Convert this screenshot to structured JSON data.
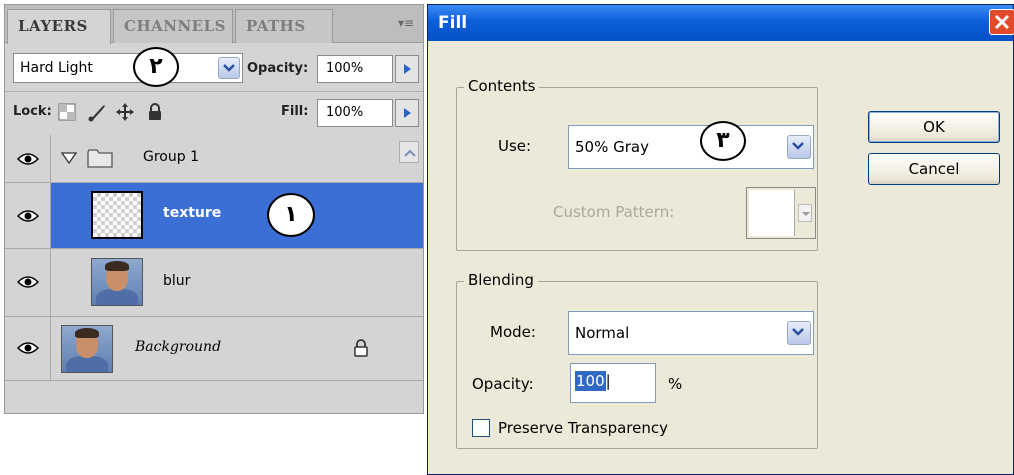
{
  "layers_panel": {
    "tabs": [
      "LAYERS",
      "CHANNELS",
      "PATHS"
    ],
    "menu_icon": "panel-menu-icon",
    "blend_mode": "Hard Light",
    "opacity_label": "Opacity:",
    "opacity_value": "100%",
    "lock_label": "Lock:",
    "fill_label": "Fill:",
    "fill_value": "100%",
    "layers": [
      {
        "name": "Group 1",
        "type": "group",
        "expanded": true
      },
      {
        "name": "texture",
        "type": "layer",
        "selected": true
      },
      {
        "name": "blur",
        "type": "layer"
      },
      {
        "name": "Background",
        "type": "background",
        "locked": true
      }
    ],
    "annotations": {
      "texture": "١",
      "blend_mode": "٢"
    }
  },
  "fill_dialog": {
    "title": "Fill",
    "contents_legend": "Contents",
    "use_label": "Use:",
    "use_value": "50% Gray",
    "custom_pattern_label": "Custom Pattern:",
    "blending_legend": "Blending",
    "mode_label": "Mode:",
    "mode_value": "Normal",
    "opacity_label": "Opacity:",
    "opacity_value": "100",
    "percent_sign": "%",
    "preserve_label": "Preserve Transparency",
    "preserve_checked": false,
    "ok_label": "OK",
    "cancel_label": "Cancel",
    "annotation_use": "٣"
  },
  "colors": {
    "selection_blue": "#3b6fd6",
    "titlebar_blue": "#0a5fd8",
    "dialog_bg": "#ece9d8",
    "panel_bg": "#d4d4d4"
  }
}
